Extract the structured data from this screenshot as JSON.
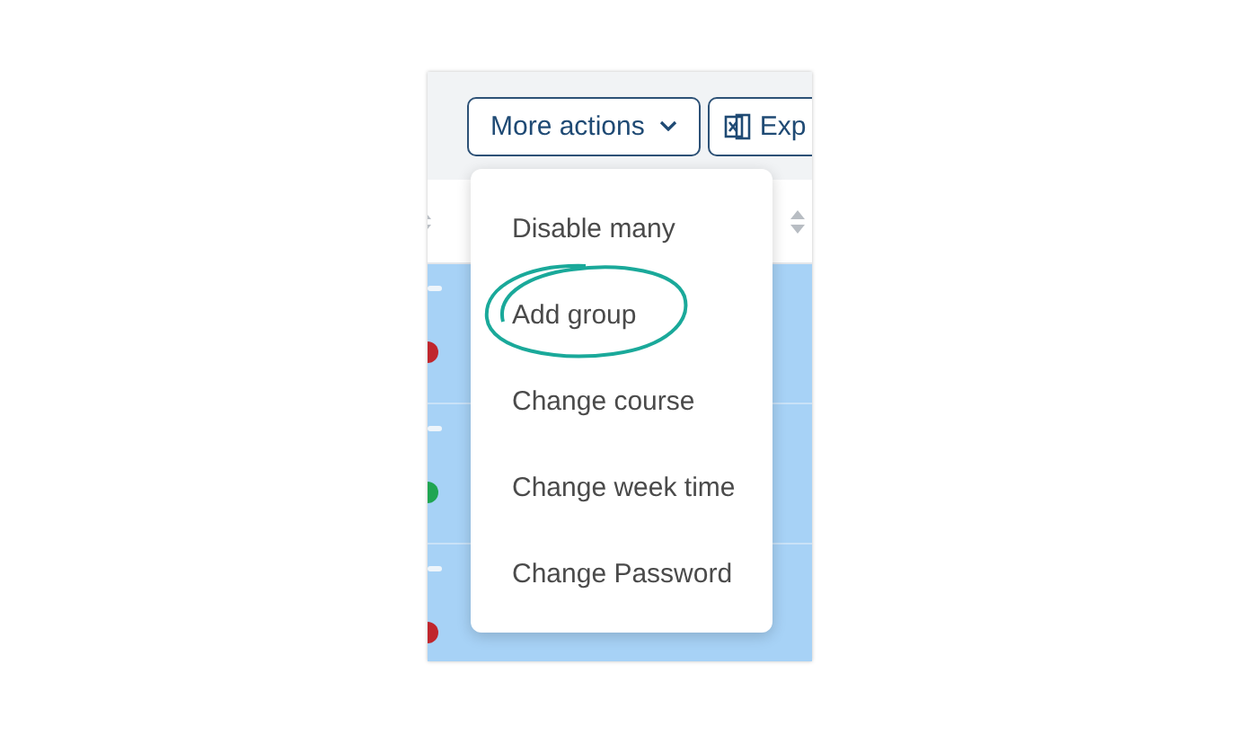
{
  "toolbar": {
    "more_actions": {
      "label": "More actions",
      "expanded": true
    },
    "export": {
      "label": "Exp"
    }
  },
  "rows": [
    {
      "color": "#c0262d"
    },
    {
      "color": "#1fa552"
    },
    {
      "color": "#c0262d"
    }
  ],
  "menu": {
    "items": [
      {
        "label": "Disable many",
        "highlighted": false
      },
      {
        "label": "Add group",
        "highlighted": true
      },
      {
        "label": "Change course",
        "highlighted": false
      },
      {
        "label": "Change week time",
        "highlighted": false
      },
      {
        "label": "Change Password",
        "highlighted": false
      }
    ]
  }
}
